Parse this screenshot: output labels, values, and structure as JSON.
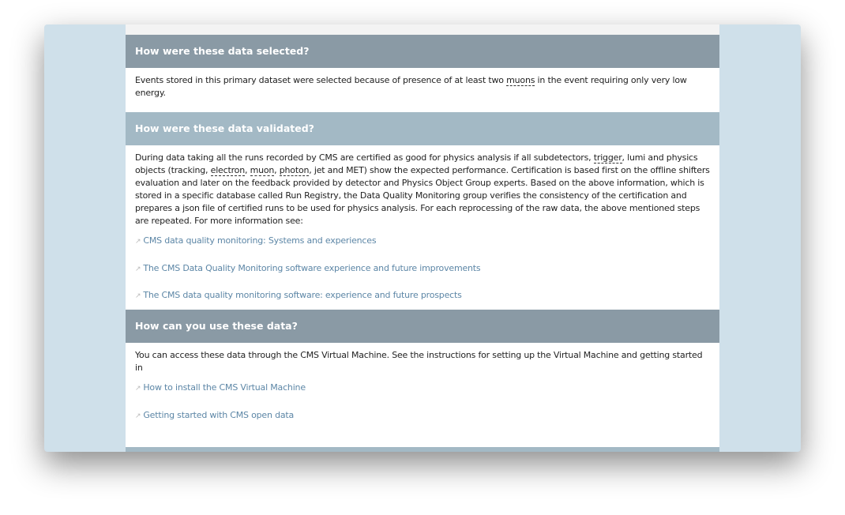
{
  "sections": [
    {
      "title": "How were these data selected?",
      "text_pre": "Events stored in this primary dataset were selected because of presence of at least two ",
      "abbr": "muons",
      "text_post": " in the event requiring only very low energy."
    },
    {
      "title": "How were these data validated?",
      "p1": "During data taking all the runs recorded by CMS are certified as good for physics analysis if all subdetectors, ",
      "a1": "trigger",
      "p2": ", lumi and physics objects (tracking, ",
      "a2": "electron",
      "p3": ", ",
      "a3": "muon",
      "p4": ", ",
      "a4": "photon",
      "p5": ", jet and MET) show the expected performance. Certification is based first on the offline shifters evaluation and later on the feedback provided by detector and Physics Object Group experts. Based on the above information, which is stored in a specific database called Run Registry, the Data Quality Monitoring group verifies the consistency of the certification and prepares a json file of certified runs to be used for physics analysis. For each reprocessing of the raw data, the above mentioned steps are repeated. For more information see:",
      "links": [
        "CMS data quality monitoring: Systems and experiences",
        "The CMS Data Quality Monitoring software experience and future improvements",
        "The CMS data quality monitoring software: experience and future prospects"
      ]
    },
    {
      "title": "How can you use these data?",
      "text": "You can access these data through the CMS Virtual Machine. See the instructions for setting up the Virtual Machine and getting started in",
      "links": [
        "How to install the CMS Virtual Machine",
        "Getting started with CMS open data"
      ]
    }
  ],
  "icons": {
    "link": "external-link-icon"
  }
}
